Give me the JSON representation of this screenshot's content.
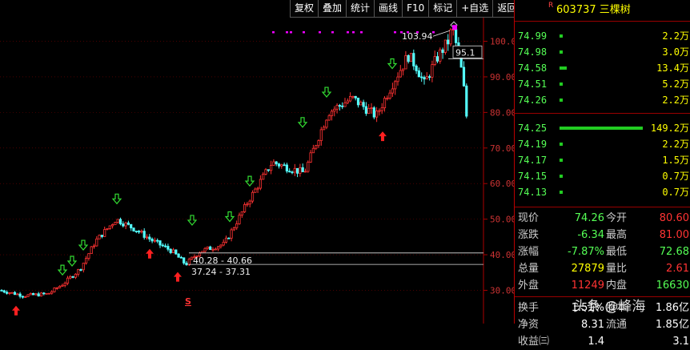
{
  "toolbar": [
    "复权",
    "叠加",
    "统计",
    "画线",
    "F10",
    "标记",
    "+自选",
    "返回"
  ],
  "chart_data": {
    "type": "candlestick",
    "y_ticks": [
      30.0,
      40.0,
      50.0,
      60.0,
      70.0,
      80.0,
      90.0,
      100.0
    ],
    "ylim": [
      22,
      108
    ],
    "annotations": {
      "peak_label": "103.94",
      "right_label": "95.1",
      "range_upper": "40.28 - 40.66",
      "range_lower": "37.24 - 37.31",
      "s_marker": "S"
    },
    "colors": {
      "up": "#ff3232",
      "down": "#54ffff",
      "buy_arrow": "#ff2020",
      "sell_arrow": "#33dd33"
    }
  },
  "stock": {
    "badge": "R",
    "code": "603737",
    "name": "三棵树"
  },
  "order_book": {
    "asks": [
      {
        "price": "74.99",
        "vol": "2.2万",
        "bar": 0.02
      },
      {
        "price": "74.98",
        "vol": "3.0万",
        "bar": 0.02
      },
      {
        "price": "74.58",
        "vol": "13.4万",
        "bar": 0.09
      },
      {
        "price": "74.51",
        "vol": "5.2万",
        "bar": 0.03
      },
      {
        "price": "74.26",
        "vol": "2.2万",
        "bar": 0.02
      }
    ],
    "bids": [
      {
        "price": "74.25",
        "vol": "149.2万",
        "bar": 1.0
      },
      {
        "price": "74.19",
        "vol": "2.2万",
        "bar": 0.02
      },
      {
        "price": "74.17",
        "vol": "1.5万",
        "bar": 0.02
      },
      {
        "price": "74.15",
        "vol": "0.7万",
        "bar": 0.02
      },
      {
        "price": "74.13",
        "vol": "0.7万",
        "bar": 0.02
      }
    ]
  },
  "quote": {
    "rows": [
      {
        "l1": "现价",
        "v1": "74.26",
        "c1": "#5f5",
        "l2": "今开",
        "v2": "80.60",
        "c2": "#f33"
      },
      {
        "l1": "涨跌",
        "v1": "-6.34",
        "c1": "#5f5",
        "l2": "最高",
        "v2": "81.00",
        "c2": "#f33"
      },
      {
        "l1": "涨幅",
        "v1": "-7.87%",
        "c1": "#5f5",
        "l2": "最低",
        "v2": "72.68",
        "c2": "#5f5"
      },
      {
        "l1": "总量",
        "v1": "27879",
        "c1": "#ff0",
        "l2": "量比",
        "v2": "2.61",
        "c2": "#f33"
      },
      {
        "l1": "外盘",
        "v1": "11249",
        "c1": "#f33",
        "l2": "内盘",
        "v2": "16630",
        "c2": "#5f5"
      }
    ],
    "rows2": [
      {
        "l1": "换手",
        "v1": "1.51%",
        "c1": "#fff",
        "l2": "股本",
        "v2": "1.86亿",
        "c2": "#fff"
      },
      {
        "l1": "净资",
        "v1": "8.31",
        "c1": "#fff",
        "l2": "流通",
        "v2": "1.85亿",
        "c2": "#fff"
      },
      {
        "l1": "收益㈢",
        "v1": "1.4",
        "c1": "#fff",
        "l2": "",
        "v2": "3.1",
        "c2": "#fff"
      }
    ]
  },
  "watermark": "头条 @峰海"
}
